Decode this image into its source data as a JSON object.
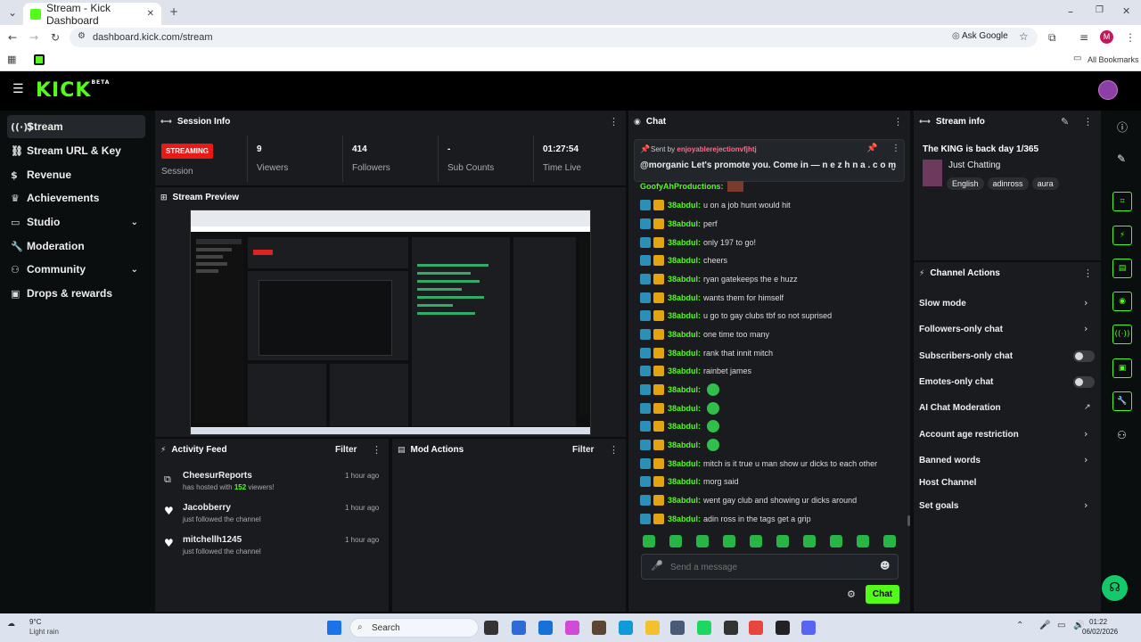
{
  "browser": {
    "tab_title": "Stream - Kick Dashboard",
    "url": "dashboard.kick.com/stream",
    "ask_google": "Ask Google",
    "profile_initial": "M",
    "bookmarks_label": "All Bookmarks"
  },
  "brand": {
    "logo": "KICK",
    "beta": "BETA",
    "accent": "#53fc18"
  },
  "sidebar": {
    "items": [
      {
        "label": "Stream",
        "icon": "broadcast-icon"
      },
      {
        "label": "Stream URL & Key",
        "icon": "link-icon"
      },
      {
        "label": "Revenue",
        "icon": "dollar-icon"
      },
      {
        "label": "Achievements",
        "icon": "trophy-icon"
      },
      {
        "label": "Studio",
        "icon": "studio-icon"
      },
      {
        "label": "Moderation",
        "icon": "wrench-icon"
      },
      {
        "label": "Community",
        "icon": "community-icon"
      },
      {
        "label": "Drops & rewards",
        "icon": "gift-icon"
      }
    ]
  },
  "session": {
    "title": "Session Info",
    "badge": "STREAMING",
    "session_label": "Session",
    "stats": [
      {
        "value": "9",
        "label": "Viewers"
      },
      {
        "value": "414",
        "label": "Followers"
      },
      {
        "value": "-",
        "label": "Sub Counts"
      },
      {
        "value": "01:27:54",
        "label": "Time Live"
      }
    ]
  },
  "preview": {
    "title": "Stream Preview"
  },
  "activity": {
    "title": "Activity Feed",
    "filter": "Filter",
    "items": [
      {
        "name": "CheesurReports",
        "pre": "has hosted with ",
        "count": "152",
        "post": " viewers!",
        "time": "1 hour ago"
      },
      {
        "name": "Jacobberry",
        "detail": "just followed the channel",
        "time": "1 hour ago"
      },
      {
        "name": "mitchellh1245",
        "detail": "just followed the channel",
        "time": "1 hour ago"
      }
    ]
  },
  "mod_actions": {
    "title": "Mod Actions",
    "filter": "Filter"
  },
  "chat": {
    "title": "Chat",
    "pinned": {
      "sent_by_label": "Sent by",
      "sender": "enjoyablerejectionvfjhtj",
      "message": "@morganic Let's promote you. Come in — n e z h n a . c o m"
    },
    "top_user": "GoofyAhProductions:",
    "messages": [
      {
        "user": "38abdul:",
        "text": "u on a job hunt would hit"
      },
      {
        "user": "38abdul:",
        "text": "perf"
      },
      {
        "user": "38abdul:",
        "text": "only 197 to go!"
      },
      {
        "user": "38abdul:",
        "text": "cheers"
      },
      {
        "user": "38abdul:",
        "text": "ryan gatekeeps the e huzz"
      },
      {
        "user": "38abdul:",
        "text": "wants them for himself"
      },
      {
        "user": "38abdul:",
        "text": "u go to gay clubs tbf so not suprised"
      },
      {
        "user": "38abdul:",
        "text": "one time too many"
      },
      {
        "user": "38abdul:",
        "text": "rank that innit mitch"
      },
      {
        "user": "38abdul:",
        "text": "rainbet james"
      },
      {
        "user": "38abdul:",
        "text": ""
      },
      {
        "user": "38abdul:",
        "text": ""
      },
      {
        "user": "38abdul:",
        "text": ""
      },
      {
        "user": "38abdul:",
        "text": ""
      },
      {
        "user": "38abdul:",
        "text": "mitch is it true u man show ur dicks to each other"
      },
      {
        "user": "38abdul:",
        "text": "morg said"
      },
      {
        "user": "38abdul:",
        "text": "went gay club and showing ur dicks around"
      },
      {
        "user": "38abdul:",
        "text": "adin ross in the tags get a grip"
      }
    ],
    "placeholder": "Send a message",
    "send_label": "Chat"
  },
  "stream_info": {
    "title": "Stream info",
    "stream_title": "The KING is back day 1/365",
    "category": "Just Chatting",
    "tags": [
      "English",
      "adinross",
      "aura"
    ]
  },
  "channel_actions": {
    "title": "Channel Actions",
    "items": [
      {
        "label": "Slow mode",
        "control": "arrow"
      },
      {
        "label": "Followers-only chat",
        "control": "arrow"
      },
      {
        "label": "Subscribers-only chat",
        "control": "toggle"
      },
      {
        "label": "Emotes-only chat",
        "control": "toggle"
      },
      {
        "label": "AI Chat Moderation",
        "control": "external"
      },
      {
        "label": "Account age restriction",
        "control": "arrow"
      },
      {
        "label": "Banned words",
        "control": "arrow"
      },
      {
        "label": "Host Channel",
        "control": "none"
      },
      {
        "label": "Set goals",
        "control": "arrow"
      }
    ]
  },
  "taskbar": {
    "weather_temp": "9°C",
    "weather_desc": "Light rain",
    "search": "Search",
    "time": "01:22",
    "date": "06/02/2026"
  }
}
